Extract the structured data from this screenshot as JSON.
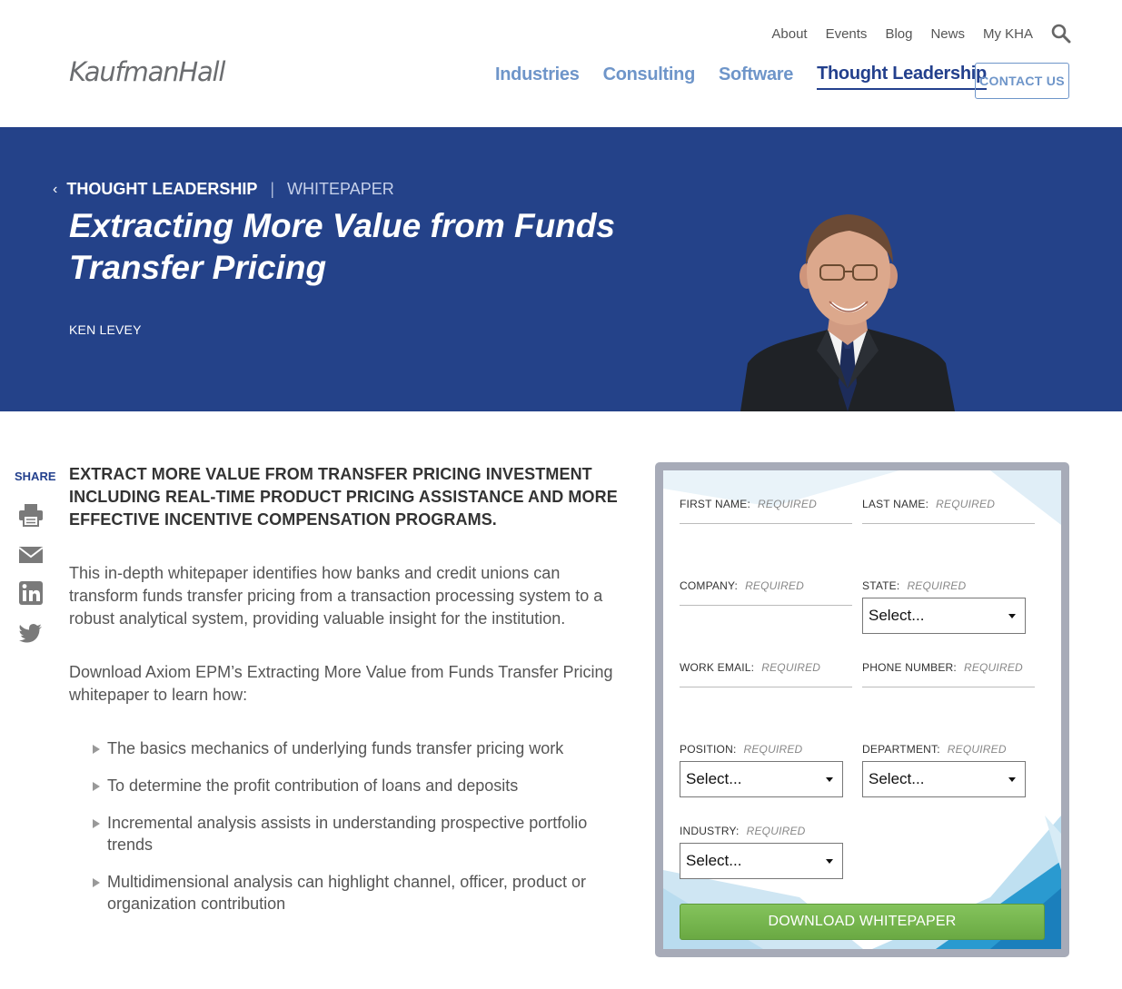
{
  "header": {
    "logo_text": "KaufmanHall",
    "utility_nav": [
      "About",
      "Events",
      "Blog",
      "News",
      "My KHA"
    ],
    "main_nav": [
      {
        "label": "Industries",
        "active": false
      },
      {
        "label": "Consulting",
        "active": false
      },
      {
        "label": "Software",
        "active": false
      },
      {
        "label": "Thought Leadership",
        "active": true
      }
    ],
    "contact_label": "CONTACT US"
  },
  "hero": {
    "breadcrumb_section": "THOUGHT LEADERSHIP",
    "breadcrumb_separator": "|",
    "breadcrumb_type": "WHITEPAPER",
    "title": "Extracting More Value from Funds Transfer Pricing",
    "author": "KEN LEVEY",
    "background_color": "#244289"
  },
  "share": {
    "label": "SHARE",
    "icons": [
      "print-icon",
      "email-icon",
      "linkedin-icon",
      "twitter-icon"
    ]
  },
  "content": {
    "lead": "EXTRACT MORE VALUE FROM TRANSFER PRICING INVESTMENT INCLUDING REAL-TIME PRODUCT PRICING ASSISTANCE AND MORE EFFECTIVE INCENTIVE COMPENSATION PROGRAMS.",
    "paragraph1": "This in-depth whitepaper identifies how banks and credit unions can transform funds transfer pricing from a transaction processing system to a robust analytical system, providing valuable insight for the institution.",
    "paragraph2": "Download Axiom EPM’s Extracting More Value from Funds Transfer Pricing whitepaper to learn how:",
    "bullets": [
      "The basics mechanics of underlying funds transfer pricing work",
      "To determine the profit contribution of loans and deposits",
      "Incremental analysis assists in understanding prospective portfolio trends",
      "Multidimensional analysis can highlight channel, officer, product or organization contribution"
    ]
  },
  "form": {
    "required_text": "REQUIRED",
    "fields": {
      "first_name": "FIRST NAME:",
      "last_name": "LAST NAME:",
      "company": "COMPANY:",
      "state": "STATE:",
      "work_email": "WORK EMAIL:",
      "phone": "PHONE NUMBER:",
      "position": "POSITION:",
      "department": "DEPARTMENT:",
      "industry": "INDUSTRY:"
    },
    "select_placeholder": "Select...",
    "submit_label": "DOWNLOAD WHITEPAPER",
    "button_color": "#76b54f"
  }
}
